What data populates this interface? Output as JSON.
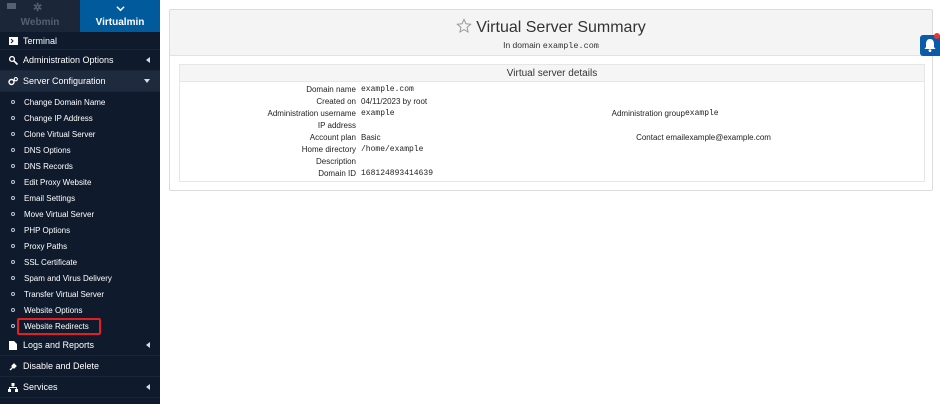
{
  "tabs": {
    "webmin": "Webmin",
    "virtualmin": "Virtualmin"
  },
  "menu": {
    "terminal": "Terminal",
    "administration_options": "Administration Options",
    "server_configuration": "Server Configuration",
    "sub_items": [
      "Change Domain Name",
      "Change IP Address",
      "Clone Virtual Server",
      "DNS Options",
      "DNS Records",
      "Edit Proxy Website",
      "Email Settings",
      "Move Virtual Server",
      "PHP Options",
      "Proxy Paths",
      "SSL Certificate",
      "Spam and Virus Delivery",
      "Transfer Virtual Server",
      "Website Options",
      "Website Redirects"
    ],
    "logs_and_reports": "Logs and Reports",
    "disable_and_delete": "Disable and Delete",
    "services": "Services"
  },
  "main": {
    "title": "Virtual Server Summary",
    "subtitle_prefix": "In domain",
    "subtitle_domain": "example.com",
    "details_title": "Virtual server details",
    "fields": {
      "domain_name_label": "Domain name",
      "domain_name_value": "example.com",
      "created_on_label": "Created on",
      "created_on_value": "04/11/2023 by root",
      "admin_username_label": "Administration username",
      "admin_username_value": "example",
      "ip_address_label": "IP address",
      "ip_address_value": "",
      "account_plan_label": "Account plan",
      "account_plan_value": "Basic",
      "home_directory_label": "Home directory",
      "home_directory_value": "/home/example",
      "description_label": "Description",
      "description_value": "",
      "domain_id_label": "Domain ID",
      "domain_id_value": "168124893414639",
      "admin_group_label": "Administration group",
      "admin_group_value": "example",
      "contact_email_label": "Contact email",
      "contact_email_value": "example@example.com"
    }
  },
  "colors": {
    "sidebar_bg": "#0f1b2d",
    "active_tab": "#005a9c",
    "highlight_border": "#e31e24"
  },
  "icons": {
    "terminal": "terminal-icon",
    "administration_options": "wrench-icon",
    "server_configuration": "cogs-icon",
    "logs_and_reports": "file-icon",
    "disable_and_delete": "plug-icon",
    "services": "sitemap-icon",
    "title": "star-icon",
    "notifications": "bell-icon"
  }
}
